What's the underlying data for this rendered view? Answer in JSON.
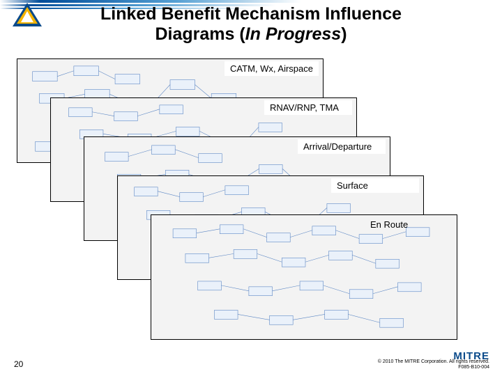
{
  "title": {
    "line1": "Linked Benefit Mechanism Influence",
    "line2_plain": "Diagrams (",
    "line2_italic": "In Progress",
    "line2_close": ")"
  },
  "panels": [
    {
      "label": "CATM, Wx, Airspace"
    },
    {
      "label": "RNAV/RNP, TMA"
    },
    {
      "label": "Arrival/Departure"
    },
    {
      "label": "Surface"
    },
    {
      "label": "En Route"
    }
  ],
  "pageNumber": "20",
  "logoText": "MITRE",
  "copyrightLine1": "© 2010 The MITRE Corporation. All rights reserved.",
  "copyrightLine2": "F085-B10-004"
}
